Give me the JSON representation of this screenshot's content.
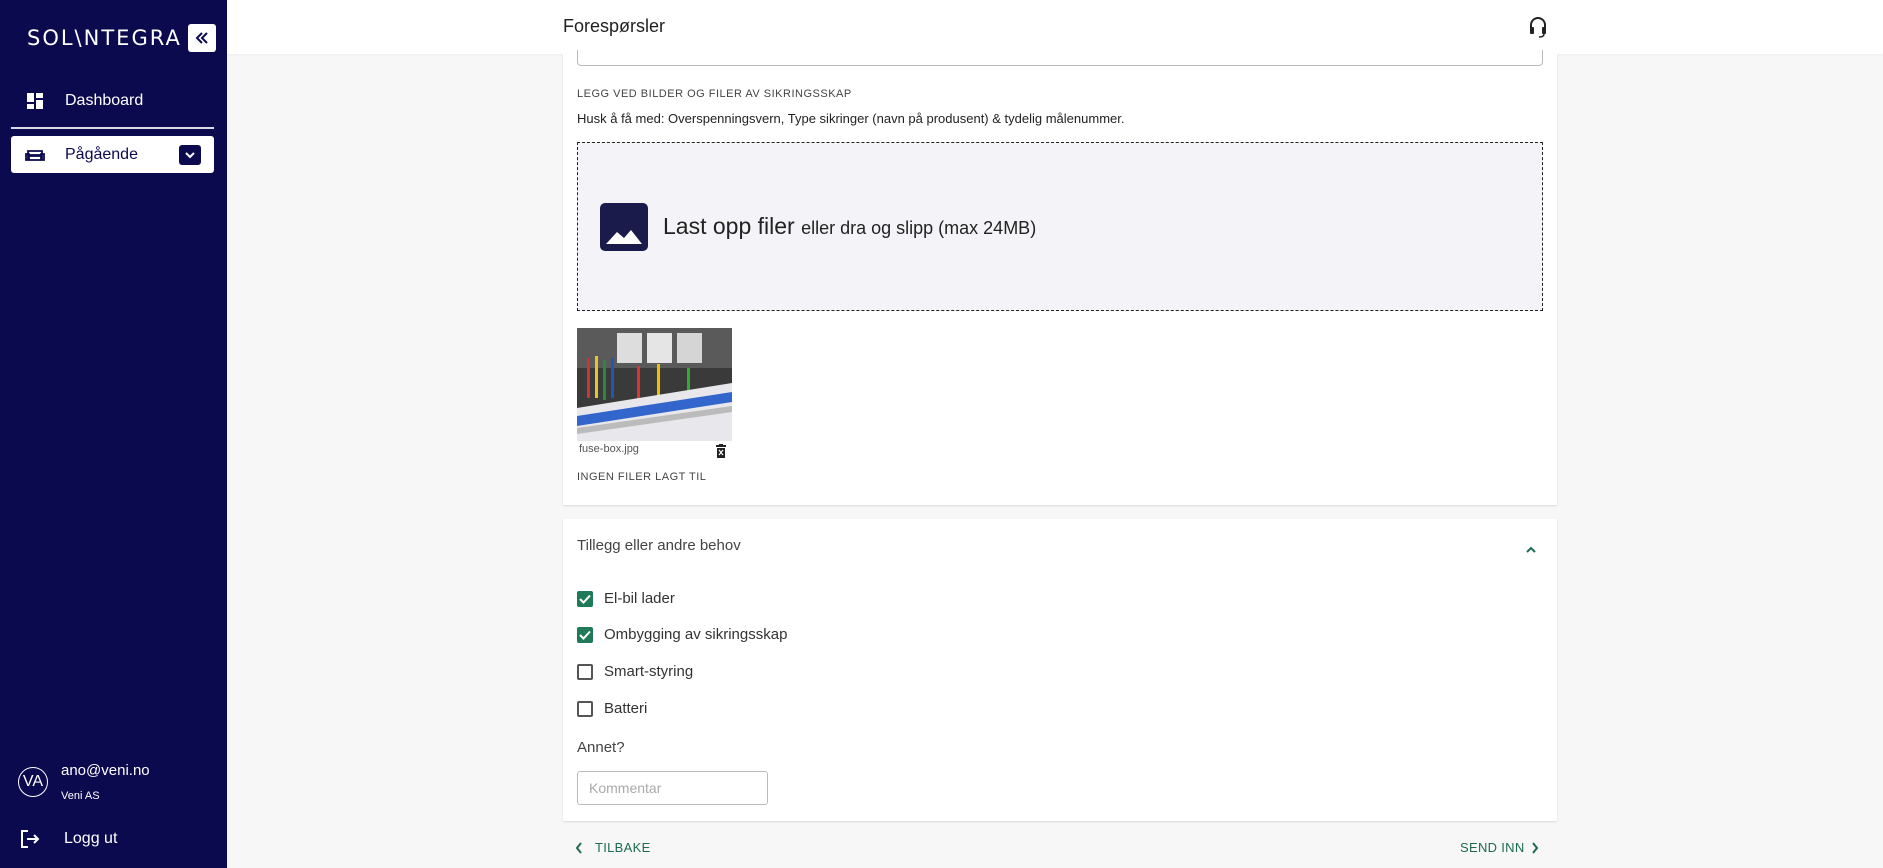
{
  "sidebar": {
    "logo": "SOL\\NTEGRA",
    "nav": {
      "dashboard": "Dashboard",
      "ongoing": "Pågående"
    },
    "user": {
      "initials": "VA",
      "email": "ano@veni.no",
      "company": "Veni AS"
    },
    "logout": "Logg ut"
  },
  "header": {
    "title": "Forespørsler"
  },
  "upload": {
    "heading": "LEGG VED BILDER OG FILER AV SIKRINGSSKAP",
    "note": "Husk å få med: Overspenningsvern, Type sikringer (navn på produsent) & tydelig målenummer.",
    "dropzone_main": "Last opp filer",
    "dropzone_sub": "eller dra og slipp (max 24MB)",
    "file_name": "fuse-box.jpg",
    "no_files": "INGEN FILER LAGT TIL"
  },
  "extras": {
    "title": "Tillegg eller andre behov",
    "options": [
      {
        "label": "El-bil lader",
        "checked": true
      },
      {
        "label": "Ombygging av sikringsskap",
        "checked": true
      },
      {
        "label": "Smart-styring",
        "checked": false
      },
      {
        "label": "Batteri",
        "checked": false
      }
    ],
    "other_label": "Annet?",
    "comment_placeholder": "Kommentar"
  },
  "footer": {
    "back": "TILBAKE",
    "submit": "SEND INN"
  },
  "colors": {
    "sidebar_bg": "#0c0a4f",
    "accent_green": "#1f7a5a"
  }
}
